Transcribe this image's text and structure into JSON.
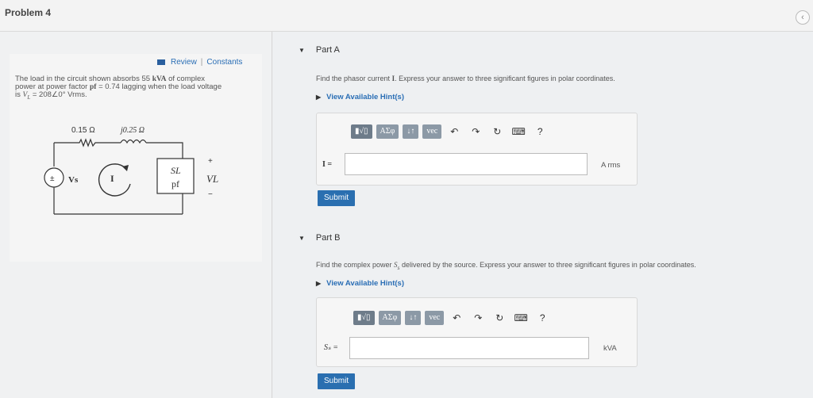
{
  "header": {
    "title": "Problem 4",
    "collapse_icon": "chevron-left-icon"
  },
  "left": {
    "review_label": "Review",
    "separator": "|",
    "constants_label": "Constants",
    "problem_line1_a": "The load in the circuit shown absorbs 55 ",
    "problem_line1_unit": "kVA",
    "problem_line1_b": " of complex",
    "problem_line2_a": "power at power factor ",
    "problem_line2_pf": "pf",
    "problem_line2_b": " = 0.74 lagging when the load voltage",
    "problem_line3_a": "is ",
    "problem_line3_math": "V",
    "problem_line3_sub": "L",
    "problem_line3_b": " = 208∠0° Vrms.",
    "circuit": {
      "r_label": "0.15 Ω",
      "x_label": "j0.25 Ω",
      "source_label": "Vs",
      "current_label": "I",
      "load_top": "SL",
      "load_bottom": "pf",
      "plus": "+",
      "minus": "−",
      "vl_label": "VL"
    }
  },
  "partA": {
    "title": "Part A",
    "instruction_a": "Find the phasor current ",
    "instruction_math": "I",
    "instruction_b": ". Express your answer to three significant figures in polar coordinates.",
    "hint_label": "View Available Hint(s)",
    "toolbar": {
      "templates": "▮√▯",
      "greek": "ΑΣφ",
      "arrows": "↓↑",
      "vec": "vec",
      "help": "?"
    },
    "input_label": "I =",
    "input_value": "",
    "unit": "A rms",
    "submit_label": "Submit"
  },
  "partB": {
    "title": "Part B",
    "instruction_a": "Find the complex power ",
    "instruction_math": "S",
    "instruction_sub": "s",
    "instruction_b": " delivered by the source. Express your answer to three significant figures in polar coordinates.",
    "hint_label": "View Available Hint(s)",
    "toolbar": {
      "templates": "▮√▯",
      "greek": "ΑΣφ",
      "arrows": "↓↑",
      "vec": "vec",
      "help": "?"
    },
    "input_label": "Sₛ =",
    "input_value": "",
    "unit": "kVA",
    "submit_label": "Submit"
  }
}
